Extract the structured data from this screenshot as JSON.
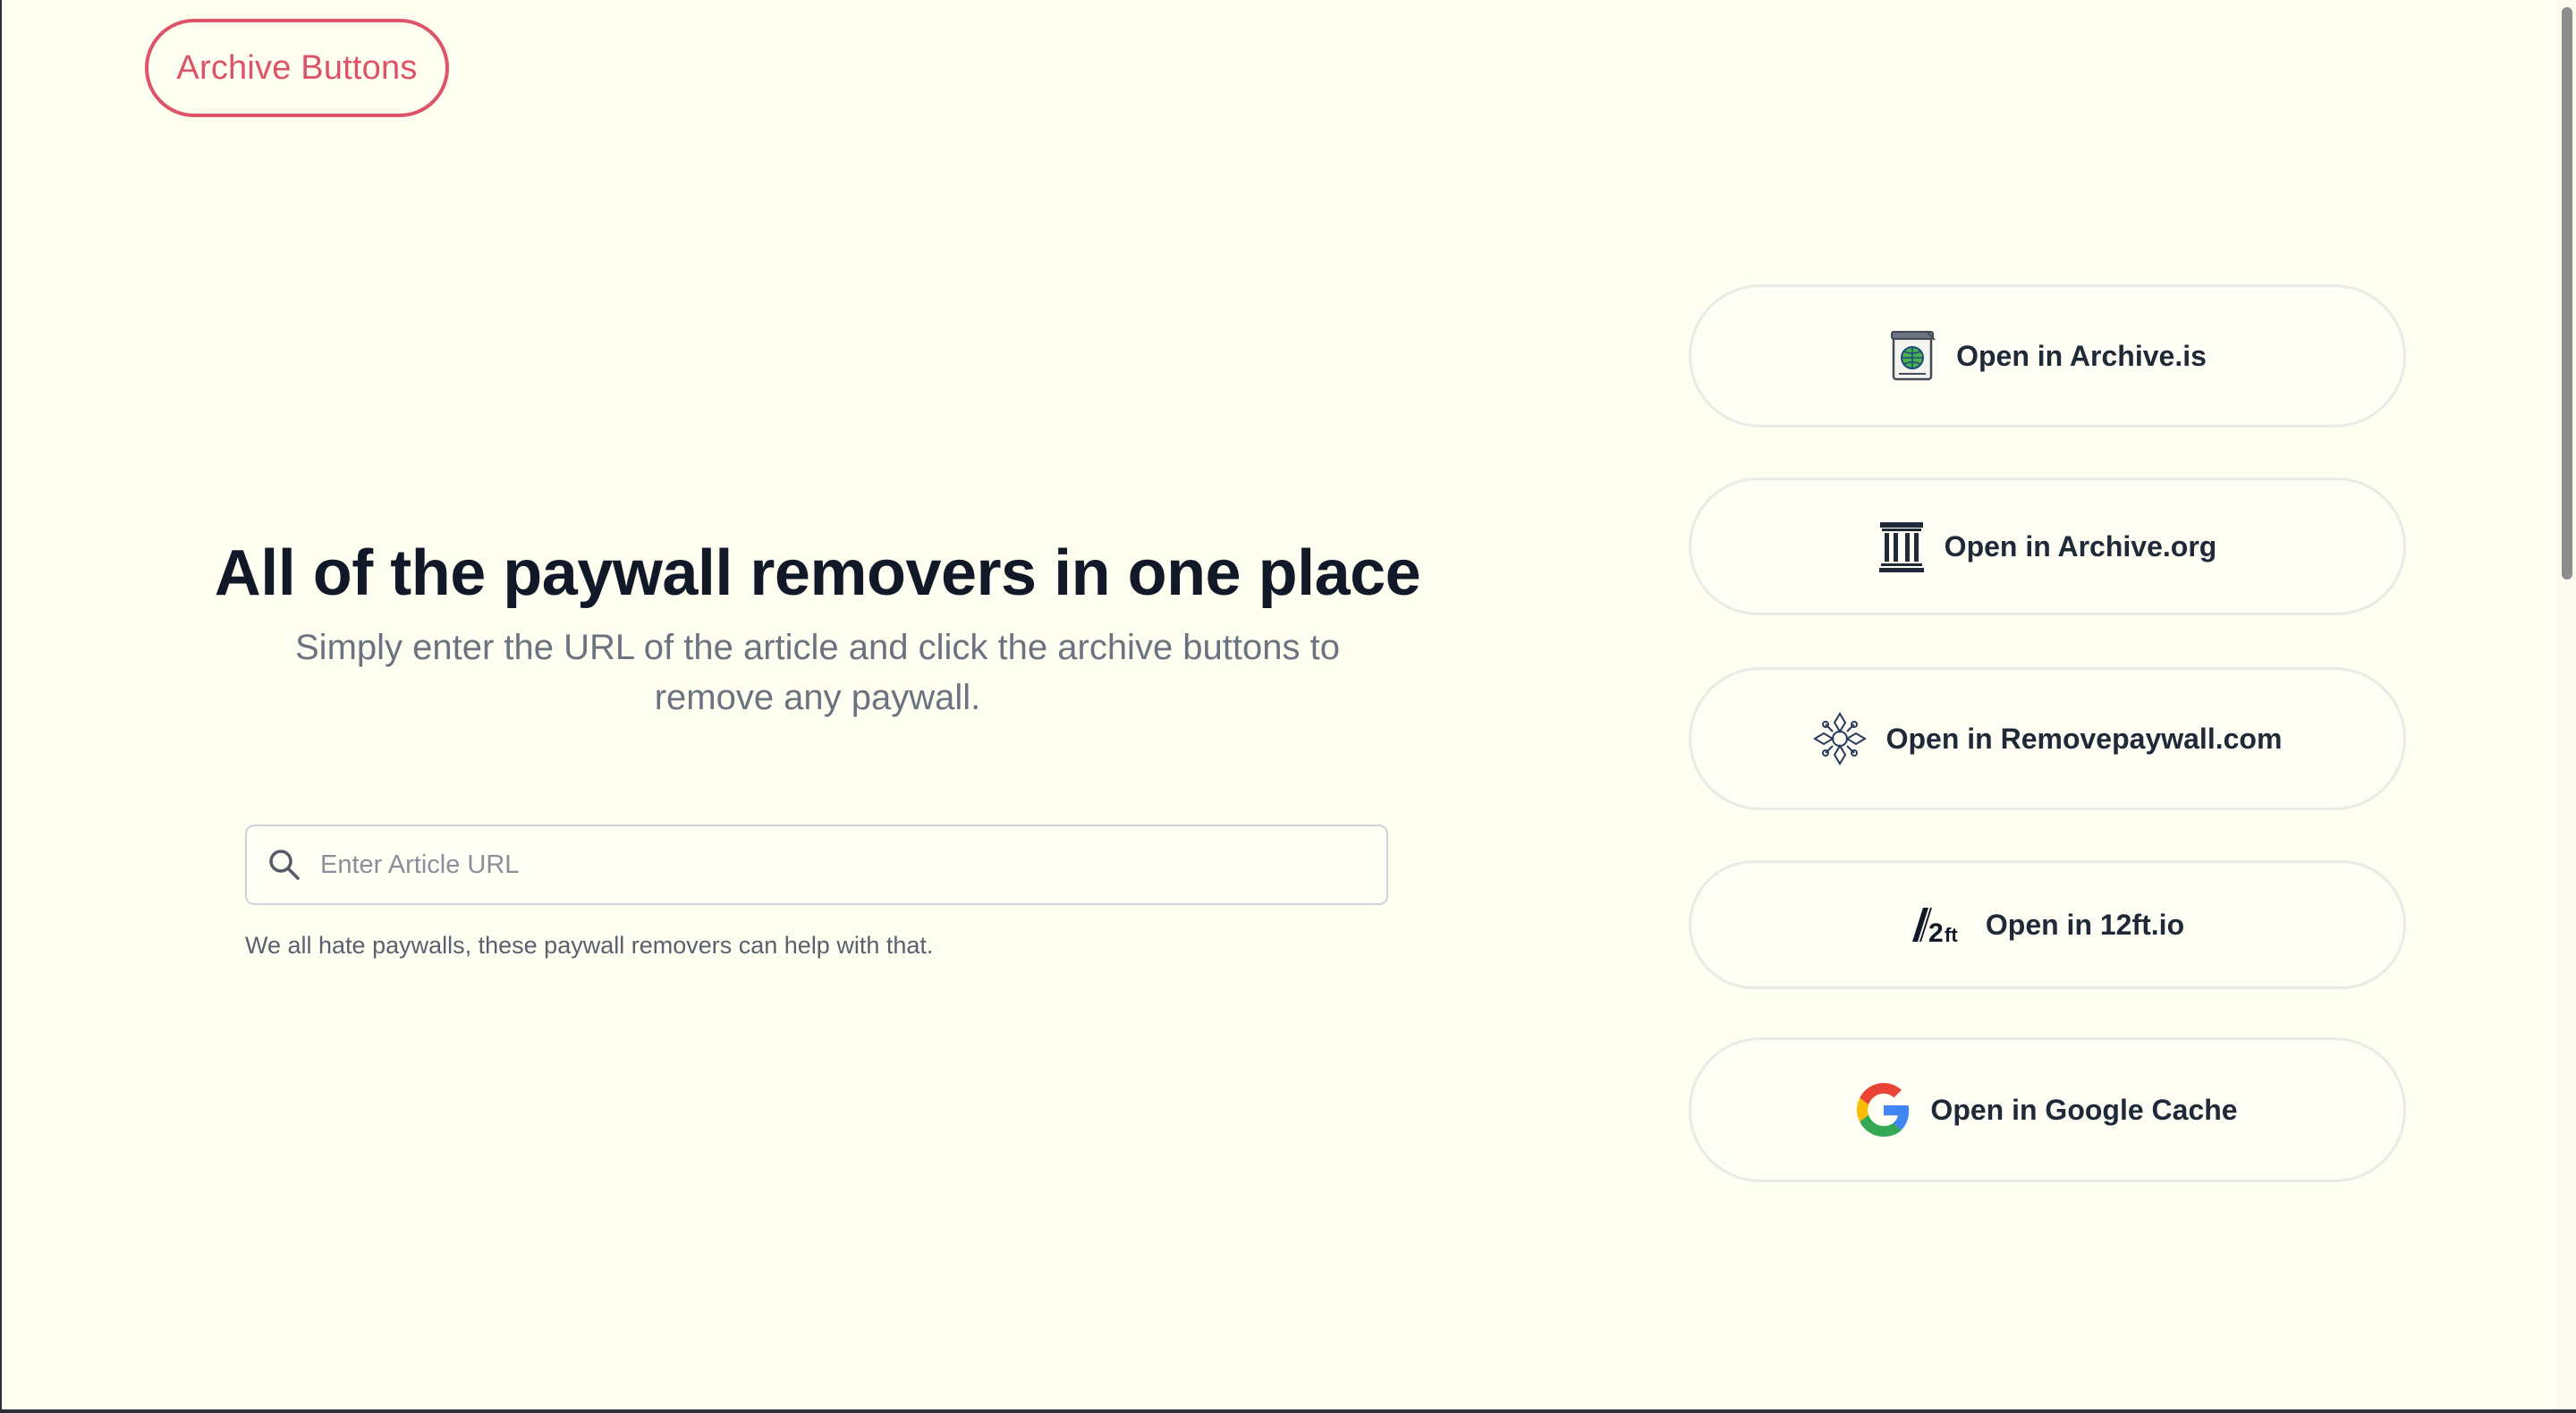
{
  "header": {
    "logo_label": "Archive Buttons"
  },
  "hero": {
    "title": "All of the paywall removers in one place",
    "subtitle": "Simply enter the URL of the article and click the archive buttons to remove any paywall."
  },
  "search": {
    "placeholder": "Enter Article URL",
    "value": "",
    "helper": "We all hate paywalls, these paywall removers can help with that."
  },
  "buttons": [
    {
      "label": "Open in Archive.is",
      "icon": "archive-is-icon"
    },
    {
      "label": "Open in Archive.org",
      "icon": "archive-org-icon"
    },
    {
      "label": "Open in Removepaywall.com",
      "icon": "removepaywall-icon"
    },
    {
      "label": "Open in 12ft.io",
      "icon": "twelve-ft-icon"
    },
    {
      "label": "Open in Google Cache",
      "icon": "google-icon"
    }
  ],
  "colors": {
    "background": "#fefef1",
    "accent": "#dd5367",
    "title": "#111827",
    "muted": "#6b7280",
    "button_border": "#ebebe6"
  }
}
